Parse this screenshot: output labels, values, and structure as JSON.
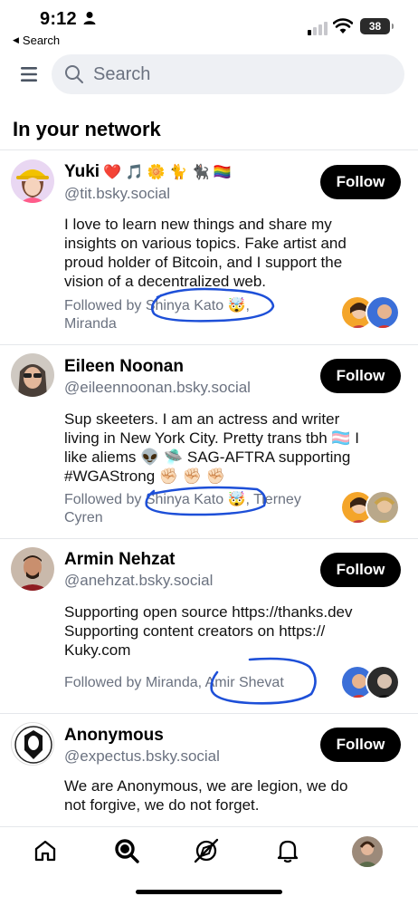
{
  "status_bar": {
    "time": "9:12",
    "back_label": "Search",
    "battery": "38"
  },
  "search": {
    "placeholder": "Search"
  },
  "section_title": "In your network",
  "profiles": [
    {
      "name": "Yuki",
      "name_emojis": "❤️ 🎵 🌼 🐈 🐈‍⬛ 🏳️‍🌈",
      "handle": "@tit.bsky.social",
      "follow_label": "Follow",
      "bio_lines": [
        "I love to learn new things and share my",
        "insights on various topics. Fake artist and",
        "proud holder of Bitcoin, and I support the",
        "vision of a decentralized web."
      ],
      "followed_by_line1": "Followed by Shinya Kato 🤯,",
      "followed_by_line2": "Miranda"
    },
    {
      "name": "Eileen Noonan",
      "handle": "@eileennoonan.bsky.social",
      "follow_label": "Follow",
      "bio_lines": [
        "Sup skeeters. I am an actress and writer",
        "living in New York City. Pretty trans tbh 🏳️‍⚧️ I",
        "like aliems 👽 🛸 SAG-AFTRA supporting",
        "#WGAStrong ✊🏻 ✊🏻 ✊🏻"
      ],
      "followed_by_line1": "Followed by Shinya Kato 🤯, Tierney",
      "followed_by_line2": "Cyren"
    },
    {
      "name": "Armin Nehzat",
      "handle": "@anehzat.bsky.social",
      "follow_label": "Follow",
      "bio_lines": [
        "Supporting open source https://thanks.dev",
        "Supporting content creators on https://",
        "Kuky.com"
      ],
      "followed_by_line1": "Followed by Miranda, Amir Shevat"
    },
    {
      "name": "Anonymous",
      "handle": "@expectus.bsky.social",
      "follow_label": "Follow",
      "bio_lines": [
        "We are Anonymous, we are legion, we do",
        "not forgive, we do not forget."
      ]
    }
  ],
  "tabs": [
    "home-icon",
    "search-icon",
    "feeds-icon",
    "notifications-icon",
    "profile-avatar"
  ],
  "colors": {
    "accent": "#000000",
    "muted_text": "#6b7280",
    "search_bg": "#eef0f4",
    "scribble": "#1d4fd8"
  }
}
